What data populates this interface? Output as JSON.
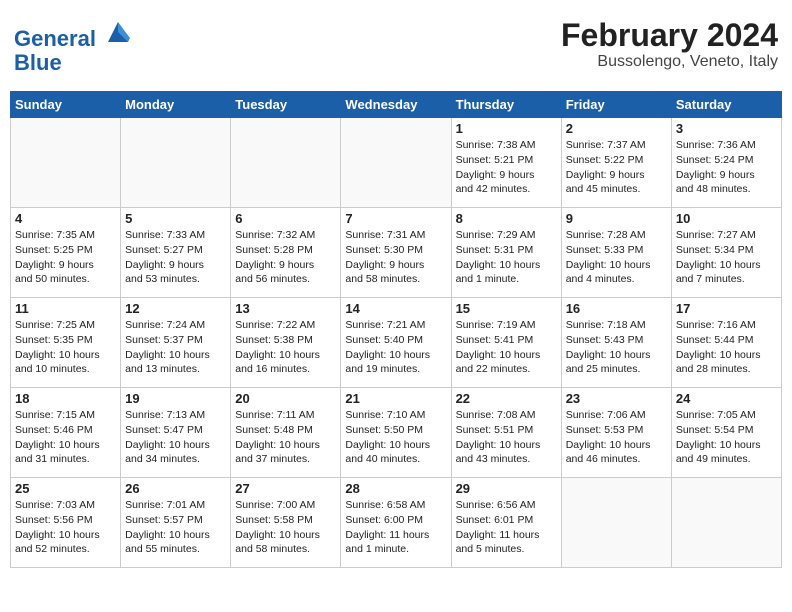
{
  "header": {
    "logo_line1": "General",
    "logo_line2": "Blue",
    "month_year": "February 2024",
    "location": "Bussolengo, Veneto, Italy"
  },
  "days_of_week": [
    "Sunday",
    "Monday",
    "Tuesday",
    "Wednesday",
    "Thursday",
    "Friday",
    "Saturday"
  ],
  "weeks": [
    [
      {
        "day": "",
        "content": ""
      },
      {
        "day": "",
        "content": ""
      },
      {
        "day": "",
        "content": ""
      },
      {
        "day": "",
        "content": ""
      },
      {
        "day": "1",
        "content": "Sunrise: 7:38 AM\nSunset: 5:21 PM\nDaylight: 9 hours\nand 42 minutes."
      },
      {
        "day": "2",
        "content": "Sunrise: 7:37 AM\nSunset: 5:22 PM\nDaylight: 9 hours\nand 45 minutes."
      },
      {
        "day": "3",
        "content": "Sunrise: 7:36 AM\nSunset: 5:24 PM\nDaylight: 9 hours\nand 48 minutes."
      }
    ],
    [
      {
        "day": "4",
        "content": "Sunrise: 7:35 AM\nSunset: 5:25 PM\nDaylight: 9 hours\nand 50 minutes."
      },
      {
        "day": "5",
        "content": "Sunrise: 7:33 AM\nSunset: 5:27 PM\nDaylight: 9 hours\nand 53 minutes."
      },
      {
        "day": "6",
        "content": "Sunrise: 7:32 AM\nSunset: 5:28 PM\nDaylight: 9 hours\nand 56 minutes."
      },
      {
        "day": "7",
        "content": "Sunrise: 7:31 AM\nSunset: 5:30 PM\nDaylight: 9 hours\nand 58 minutes."
      },
      {
        "day": "8",
        "content": "Sunrise: 7:29 AM\nSunset: 5:31 PM\nDaylight: 10 hours\nand 1 minute."
      },
      {
        "day": "9",
        "content": "Sunrise: 7:28 AM\nSunset: 5:33 PM\nDaylight: 10 hours\nand 4 minutes."
      },
      {
        "day": "10",
        "content": "Sunrise: 7:27 AM\nSunset: 5:34 PM\nDaylight: 10 hours\nand 7 minutes."
      }
    ],
    [
      {
        "day": "11",
        "content": "Sunrise: 7:25 AM\nSunset: 5:35 PM\nDaylight: 10 hours\nand 10 minutes."
      },
      {
        "day": "12",
        "content": "Sunrise: 7:24 AM\nSunset: 5:37 PM\nDaylight: 10 hours\nand 13 minutes."
      },
      {
        "day": "13",
        "content": "Sunrise: 7:22 AM\nSunset: 5:38 PM\nDaylight: 10 hours\nand 16 minutes."
      },
      {
        "day": "14",
        "content": "Sunrise: 7:21 AM\nSunset: 5:40 PM\nDaylight: 10 hours\nand 19 minutes."
      },
      {
        "day": "15",
        "content": "Sunrise: 7:19 AM\nSunset: 5:41 PM\nDaylight: 10 hours\nand 22 minutes."
      },
      {
        "day": "16",
        "content": "Sunrise: 7:18 AM\nSunset: 5:43 PM\nDaylight: 10 hours\nand 25 minutes."
      },
      {
        "day": "17",
        "content": "Sunrise: 7:16 AM\nSunset: 5:44 PM\nDaylight: 10 hours\nand 28 minutes."
      }
    ],
    [
      {
        "day": "18",
        "content": "Sunrise: 7:15 AM\nSunset: 5:46 PM\nDaylight: 10 hours\nand 31 minutes."
      },
      {
        "day": "19",
        "content": "Sunrise: 7:13 AM\nSunset: 5:47 PM\nDaylight: 10 hours\nand 34 minutes."
      },
      {
        "day": "20",
        "content": "Sunrise: 7:11 AM\nSunset: 5:48 PM\nDaylight: 10 hours\nand 37 minutes."
      },
      {
        "day": "21",
        "content": "Sunrise: 7:10 AM\nSunset: 5:50 PM\nDaylight: 10 hours\nand 40 minutes."
      },
      {
        "day": "22",
        "content": "Sunrise: 7:08 AM\nSunset: 5:51 PM\nDaylight: 10 hours\nand 43 minutes."
      },
      {
        "day": "23",
        "content": "Sunrise: 7:06 AM\nSunset: 5:53 PM\nDaylight: 10 hours\nand 46 minutes."
      },
      {
        "day": "24",
        "content": "Sunrise: 7:05 AM\nSunset: 5:54 PM\nDaylight: 10 hours\nand 49 minutes."
      }
    ],
    [
      {
        "day": "25",
        "content": "Sunrise: 7:03 AM\nSunset: 5:56 PM\nDaylight: 10 hours\nand 52 minutes."
      },
      {
        "day": "26",
        "content": "Sunrise: 7:01 AM\nSunset: 5:57 PM\nDaylight: 10 hours\nand 55 minutes."
      },
      {
        "day": "27",
        "content": "Sunrise: 7:00 AM\nSunset: 5:58 PM\nDaylight: 10 hours\nand 58 minutes."
      },
      {
        "day": "28",
        "content": "Sunrise: 6:58 AM\nSunset: 6:00 PM\nDaylight: 11 hours\nand 1 minute."
      },
      {
        "day": "29",
        "content": "Sunrise: 6:56 AM\nSunset: 6:01 PM\nDaylight: 11 hours\nand 5 minutes."
      },
      {
        "day": "",
        "content": ""
      },
      {
        "day": "",
        "content": ""
      }
    ]
  ]
}
